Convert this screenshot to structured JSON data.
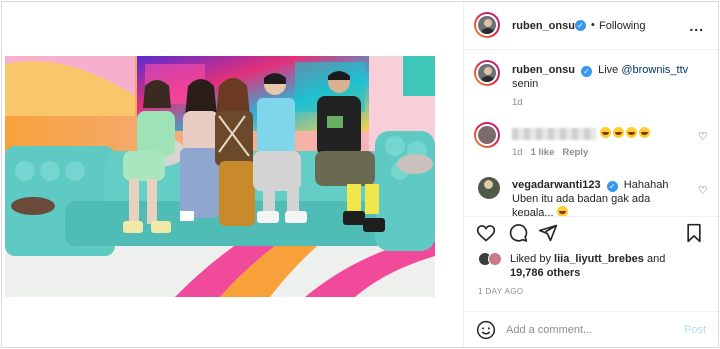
{
  "post": {
    "image_alt": "Six people seated on a teal sofa in a colorful TV studio set"
  },
  "header": {
    "username": "ruben_onsu",
    "separator": "•",
    "follow_status": "Following",
    "more_label": "..."
  },
  "caption": {
    "username": "ruben_onsu",
    "text_prefix": "Live ",
    "mention": "@brownis_ttv",
    "second_line": "senin",
    "age": "1d"
  },
  "comments": [
    {
      "username_hidden": true,
      "emoji_count": 4,
      "age": "1d",
      "likes": "1 like",
      "reply_label": "Reply"
    },
    {
      "username": "vegadarwanti123",
      "text": "Hahahah Uben itu ada badan gak ada kepala..."
    }
  ],
  "likes": {
    "prefix": "Liked by ",
    "user": "liia_liyutt_brebes",
    "and": " and",
    "others": "19,786 others"
  },
  "timestamp": "1 DAY AGO",
  "add_comment": {
    "placeholder": "Add a comment...",
    "post_label": "Post"
  },
  "icons": [
    "heart-icon",
    "comment-icon",
    "share-icon",
    "bookmark-icon",
    "emoji-icon",
    "verified-icon",
    "more-icon"
  ],
  "colors": {
    "verified": "#3897f0",
    "link": "#00376b",
    "muted": "#8e8e8e",
    "post_disabled": "#b2dffc"
  }
}
